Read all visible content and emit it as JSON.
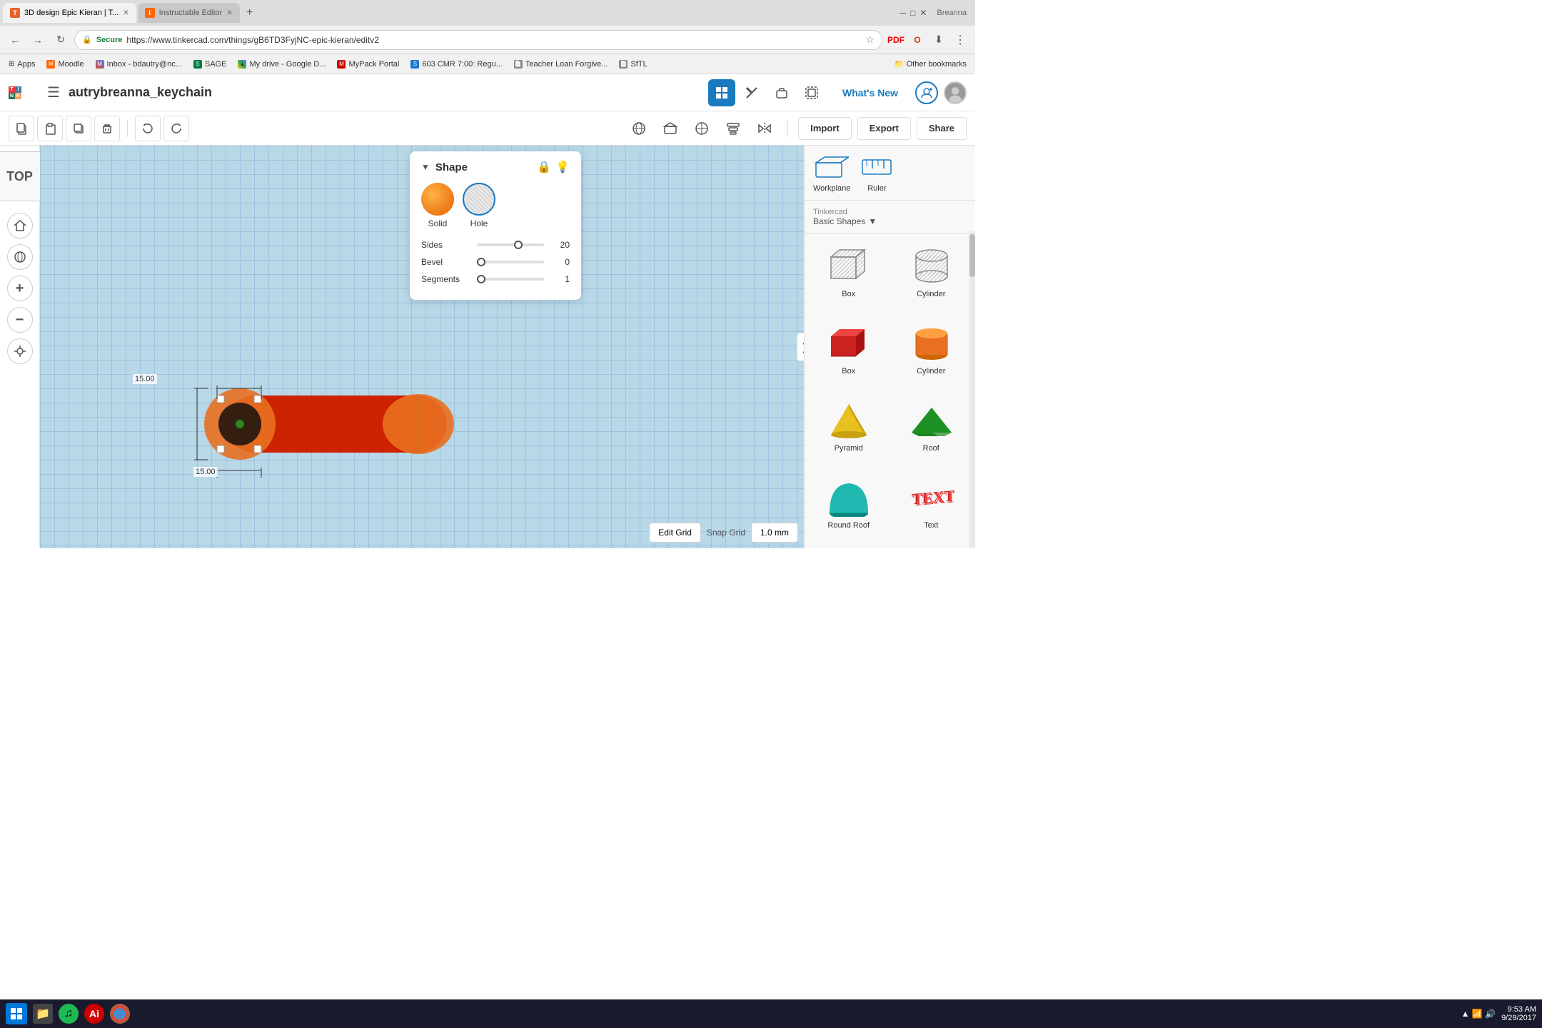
{
  "browser": {
    "tabs": [
      {
        "id": "tab1",
        "label": "3D design Epic Kieran |  T...",
        "active": true,
        "favicon": "T"
      },
      {
        "id": "tab2",
        "label": "Instructable Editor",
        "active": false,
        "favicon": "I"
      }
    ],
    "url": "https://www.tinkercad.com/things/gB6TD3FyjNC-epic-kieran/editv2",
    "bookmarks": [
      {
        "label": "Apps"
      },
      {
        "label": "Moodle"
      },
      {
        "label": "Inbox - bdautry@nc..."
      },
      {
        "label": "SAGE"
      },
      {
        "label": "My drive - Google D..."
      },
      {
        "label": "MyPack Portal"
      },
      {
        "label": "603 CMR 7:00: Regu..."
      },
      {
        "label": "Teacher Loan Forgive..."
      },
      {
        "label": "SfTL"
      }
    ],
    "other_bookmarks": "Other bookmarks"
  },
  "app": {
    "project_name": "autrybreanna_keychain",
    "header_tools": [
      {
        "id": "grid-view",
        "icon": "⊞",
        "active": true
      },
      {
        "id": "pickaxe",
        "icon": "⛏",
        "active": false
      },
      {
        "id": "briefcase",
        "icon": "💼",
        "active": false
      },
      {
        "id": "group",
        "icon": "⊡",
        "active": false
      }
    ],
    "whats_new": "What's New",
    "import_label": "Import",
    "export_label": "Export",
    "share_label": "Share"
  },
  "edit_toolbar": {
    "copy_label": "copy",
    "paste_label": "paste",
    "duplicate_label": "duplicate",
    "delete_label": "delete",
    "undo_label": "undo",
    "redo_label": "redo"
  },
  "view": {
    "view_label": "TOP"
  },
  "shape_panel": {
    "title": "Shape",
    "solid_label": "Solid",
    "hole_label": "Hole",
    "sides_label": "Sides",
    "sides_value": "20",
    "bevel_label": "Bevel",
    "bevel_value": "0",
    "segments_label": "Segments",
    "segments_value": "1"
  },
  "canvas": {
    "edit_grid_label": "Edit Grid",
    "snap_grid_label": "Snap Grid",
    "snap_grid_value": "1.0 mm",
    "dim1": "15.00",
    "dim2": "15.00"
  },
  "right_panel": {
    "breadcrumb": "Tinkercad",
    "dropdown_label": "Basic Shapes",
    "workplane_label": "Workplane",
    "ruler_label": "Ruler",
    "shapes": [
      {
        "id": "box-gray",
        "label": "Box",
        "color": "gray",
        "type": "box-wireframe"
      },
      {
        "id": "cylinder-gray",
        "label": "Cylinder",
        "color": "gray",
        "type": "cylinder-wireframe"
      },
      {
        "id": "box-red",
        "label": "Box",
        "color": "red",
        "type": "box-solid"
      },
      {
        "id": "cylinder-orange",
        "label": "Cylinder",
        "color": "orange",
        "type": "cylinder-solid"
      },
      {
        "id": "pyramid-yellow",
        "label": "Pyramid",
        "color": "yellow",
        "type": "pyramid-solid"
      },
      {
        "id": "roof-green",
        "label": "Roof",
        "color": "green",
        "type": "roof-solid"
      },
      {
        "id": "round-roof-teal",
        "label": "Round Roof",
        "color": "teal",
        "type": "round-roof-solid"
      },
      {
        "id": "text-red",
        "label": "Text",
        "color": "red",
        "type": "text-solid"
      }
    ]
  },
  "taskbar": {
    "time": "9:53 AM",
    "date": "9/29/2017",
    "icons": [
      "⊞",
      "📁",
      "🎵",
      "🔴",
      "🌐"
    ]
  }
}
